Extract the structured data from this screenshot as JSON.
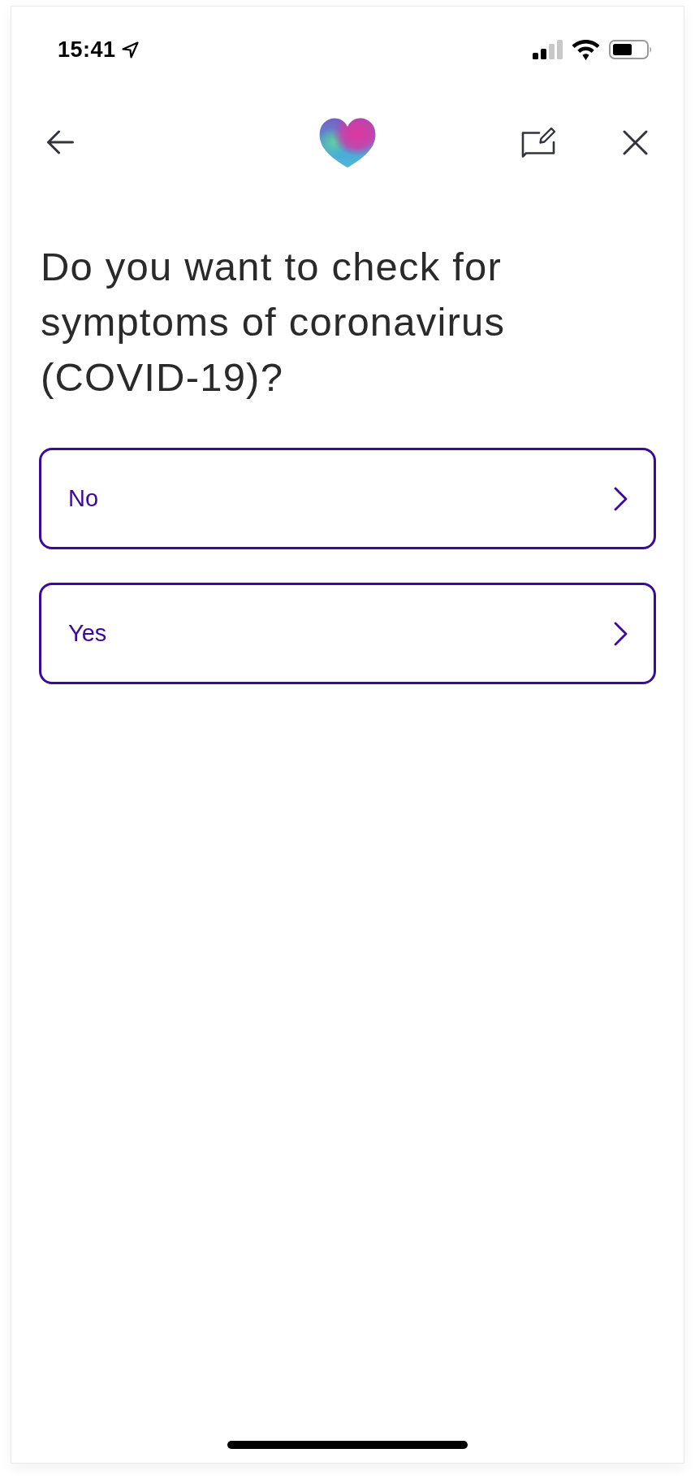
{
  "status_bar": {
    "time": "15:41"
  },
  "question": {
    "title": "Do you want to check for symptoms of coronavirus (COVID-19)?"
  },
  "options": [
    {
      "label": "No"
    },
    {
      "label": "Yes"
    }
  ]
}
